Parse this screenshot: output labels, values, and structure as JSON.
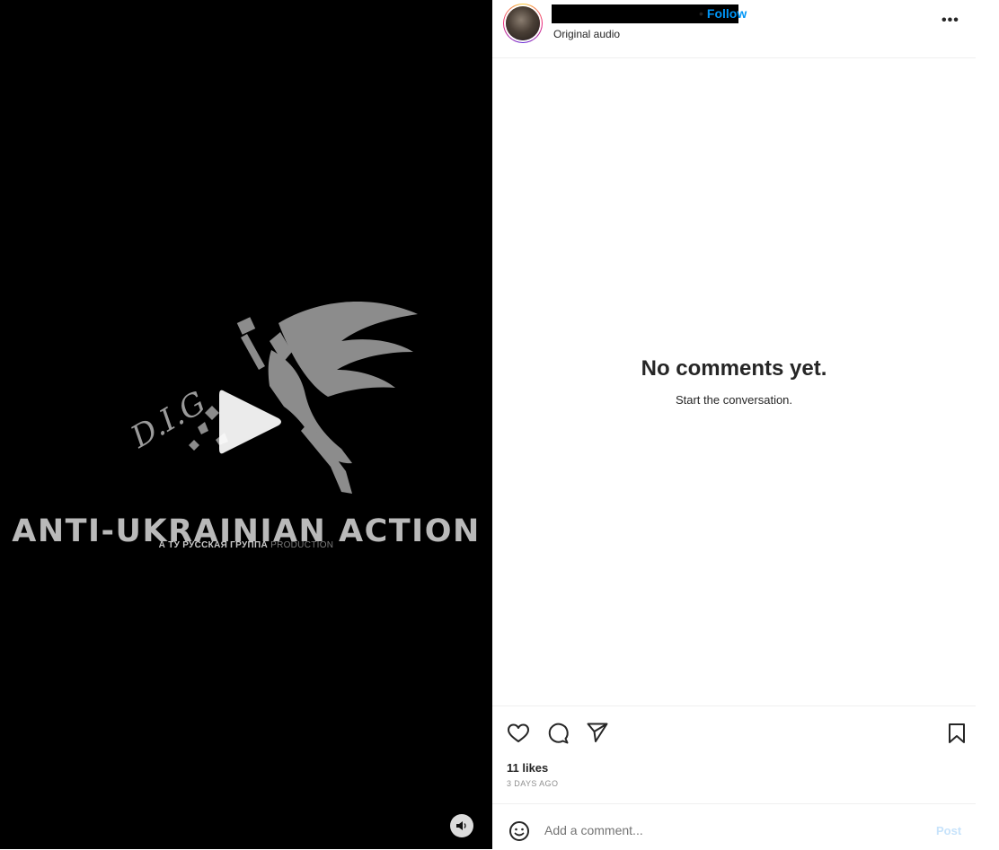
{
  "video": {
    "overlay_title": "ANTI-UKRAINIAN ACTION",
    "overlay_subtitle_main": "А ТУ РУССКАЯ ГРУППА",
    "overlay_subtitle_tail": "PRODUCTION",
    "logo_script": "D.I.G",
    "play_icon": "play-icon",
    "mute_icon": "speaker-icon"
  },
  "header": {
    "follow_separator": "•",
    "follow_label": "Follow",
    "audio_label": "Original audio",
    "more_label": "•••"
  },
  "comments": {
    "empty_title": "No comments yet.",
    "empty_subtitle": "Start the conversation."
  },
  "actions": {
    "icons": [
      "heart-icon",
      "comment-icon",
      "share-icon",
      "bookmark-icon"
    ],
    "likes": "11 likes",
    "date": "3 DAYS AGO"
  },
  "comment_box": {
    "placeholder": "Add a comment...",
    "post_label": "Post"
  },
  "colors": {
    "accent": "#0095f6",
    "video_bg": "#000000",
    "overlay_text": "#b9b9b9"
  }
}
